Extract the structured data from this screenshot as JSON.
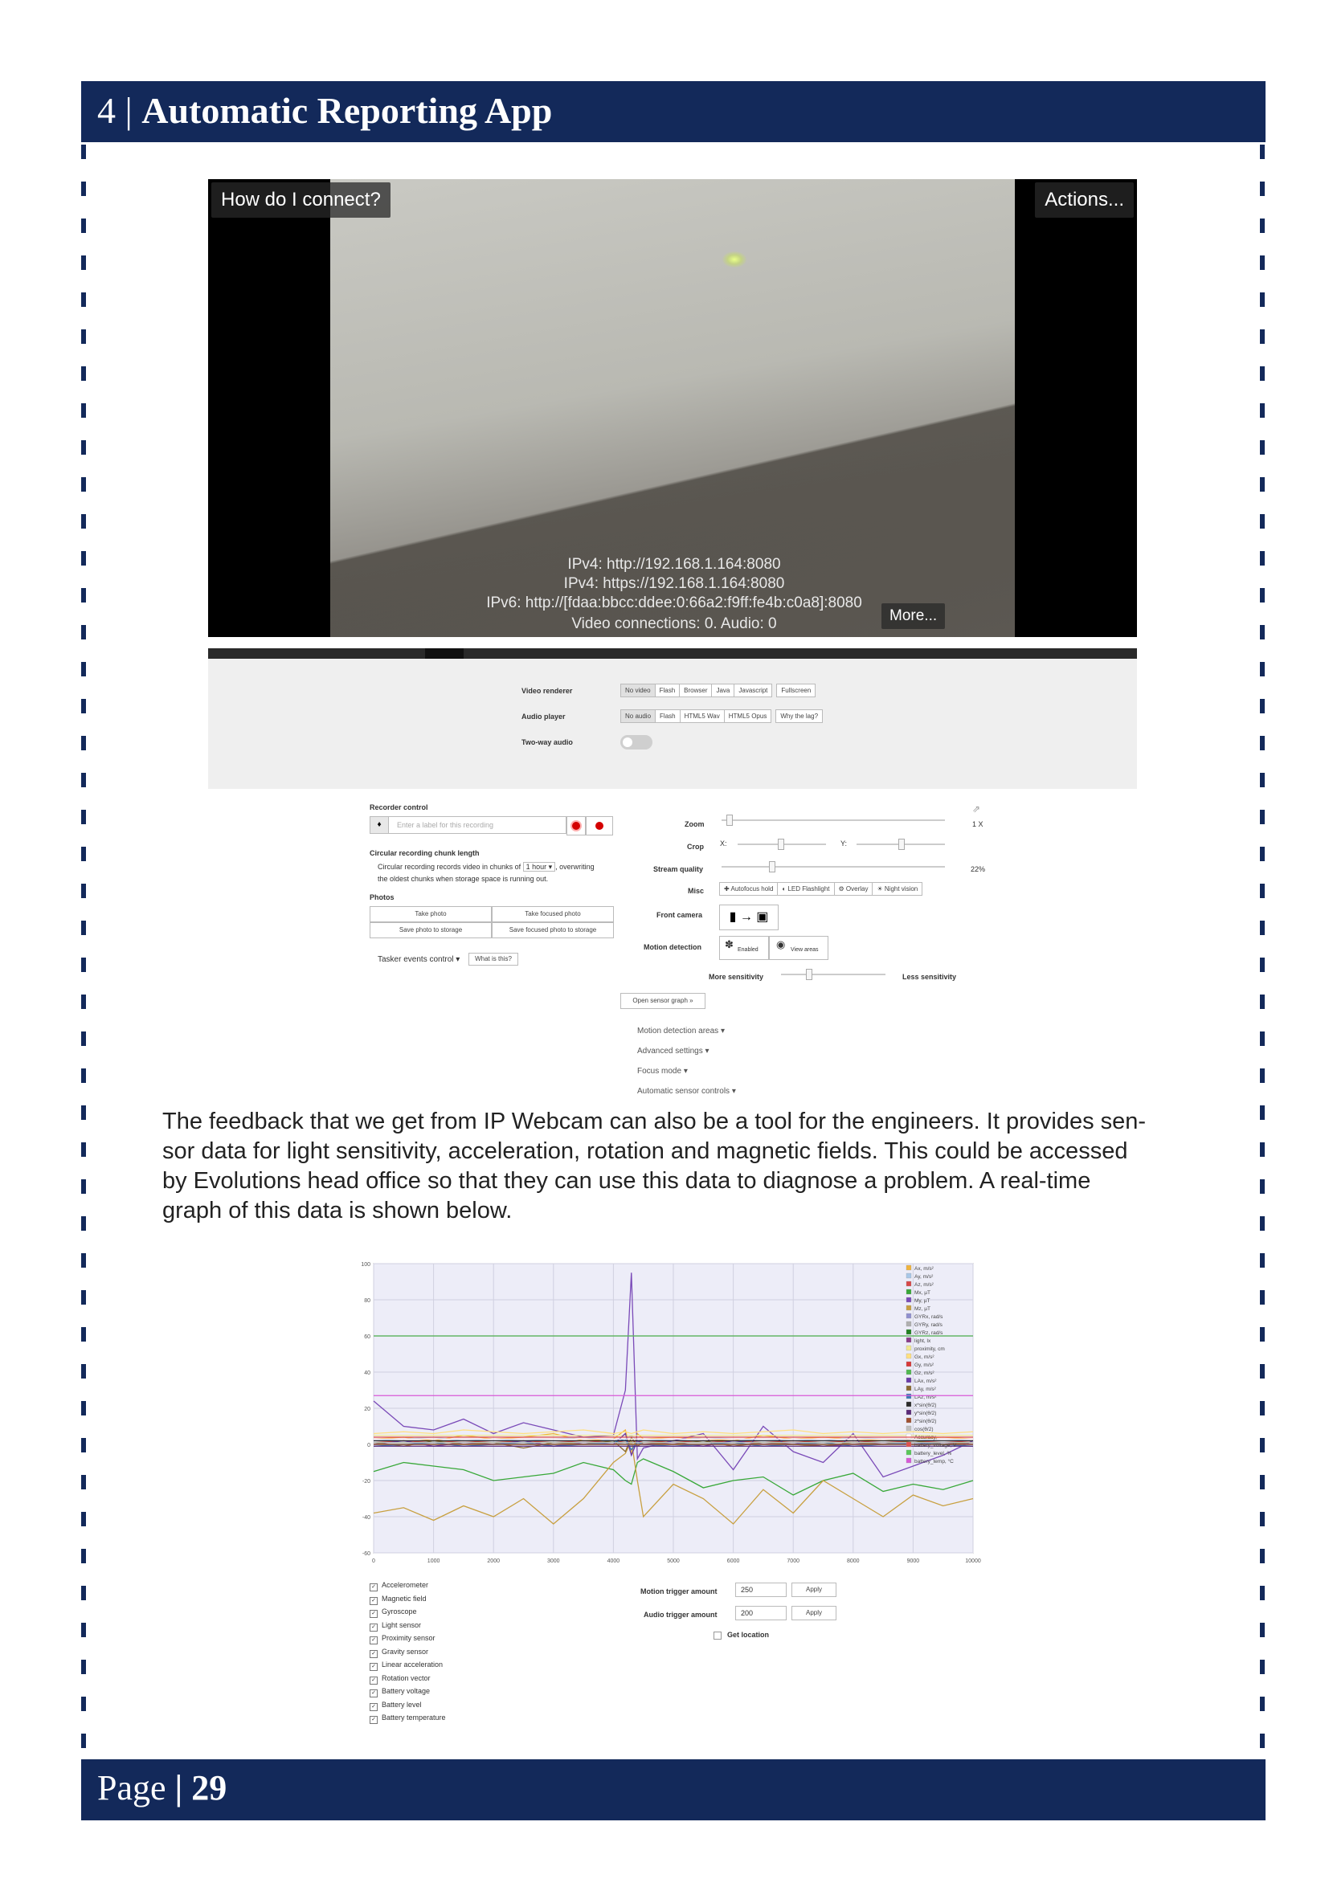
{
  "header": {
    "number": "4",
    "separator": "|",
    "title": "Automatic Reporting App"
  },
  "footer": {
    "label": "Page",
    "separator": "|",
    "number": "29"
  },
  "video": {
    "connect_button": "How do I connect?",
    "actions_button": "Actions...",
    "more_button": "More...",
    "lines": [
      "IPv4: http://192.168.1.164:8080",
      "IPv4: https://192.168.1.164:8080",
      "IPv6: http://[fdaa:bbcc:ddee:0:66a2:f9ff:fe4b:c0a8]:8080",
      "Video connections: 0. Audio: 0"
    ]
  },
  "settings": {
    "video_renderer_label": "Video renderer",
    "video_renderer_options": [
      "No video",
      "Flash",
      "Browser",
      "Java",
      "Javascript",
      "Fullscreen"
    ],
    "audio_player_label": "Audio player",
    "audio_player_options": [
      "No audio",
      "Flash",
      "HTML5 Wav",
      "HTML5 Opus",
      "Why the lag?"
    ],
    "two_way_audio_label": "Two-way audio"
  },
  "recorder": {
    "title": "Recorder control",
    "placeholder": "Enter a label for this recording",
    "chunk_title": "Circular recording chunk length",
    "chunk_text_1": "Circular recording records video in chunks of",
    "chunk_value": "1 hour",
    "chunk_text_2": ", overwriting",
    "chunk_text_3": "the oldest chunks when storage space is running out.",
    "photos_title": "Photos",
    "photo_buttons": [
      "Take photo",
      "Take focused photo",
      "Save photo to storage",
      "Save focused photo to storage"
    ],
    "tasker_label": "Tasker events control",
    "tasker_help": "What is this?"
  },
  "controls": {
    "zoom_label": "Zoom",
    "zoom_value": "1 X",
    "crop_label": "Crop",
    "crop_x": "X:",
    "crop_y": "Y:",
    "quality_label": "Stream quality",
    "quality_value": "22%",
    "misc_label": "Misc",
    "misc_buttons": [
      "Autofocus hold",
      "LED Flashlight",
      "Overlay",
      "Night vision"
    ],
    "front_camera_label": "Front camera",
    "motion_label": "Motion detection",
    "motion_enabled": "Enabled",
    "motion_view": "View areas",
    "more_sensitivity": "More sensitivity",
    "less_sensitivity": "Less sensitivity",
    "sensor_graph_button": "Open sensor graph »",
    "links": [
      "Motion detection areas",
      "Advanced settings",
      "Focus mode",
      "Automatic sensor controls"
    ]
  },
  "paragraph": [
    "The feedback that we get from IP Webcam can also be a tool for the engineers. It provides sen-",
    "sor data for light sensitivity, acceleration, rotation and magnetic fields. This could be accessed",
    "by Evolutions head office so that they can use this data to diagnose a problem. A real-time",
    "graph of this data is shown below."
  ],
  "chart_data": {
    "type": "line",
    "title": "",
    "xlabel": "",
    "ylabel": "",
    "xlim": [
      0,
      10000
    ],
    "ylim": [
      -60,
      100
    ],
    "x_ticks": [
      0,
      1000,
      2000,
      3000,
      4000,
      5000,
      6000,
      7000,
      8000,
      9000,
      10000
    ],
    "y_ticks": [
      100,
      80,
      60,
      40,
      20,
      0,
      -20,
      -40,
      -60
    ],
    "grid": true,
    "legend_position": "right",
    "x": [
      0,
      500,
      1000,
      1500,
      2000,
      2500,
      3000,
      3500,
      4000,
      4200,
      4300,
      4400,
      4500,
      5000,
      5500,
      6000,
      6500,
      7000,
      7500,
      8000,
      8500,
      9000,
      9500,
      10000
    ],
    "series": [
      {
        "name": "Ax, m/s²",
        "color": "#f0b43c",
        "values": [
          3,
          4,
          2,
          5,
          3,
          4,
          6,
          2,
          3,
          8,
          -5,
          6,
          3,
          4,
          3,
          2,
          5,
          3,
          4,
          3,
          2,
          3,
          4,
          3
        ]
      },
      {
        "name": "Ay, m/s²",
        "color": "#a8c8e8",
        "values": [
          2,
          3,
          4,
          2,
          3,
          2,
          3,
          4,
          2,
          3,
          5,
          2,
          3,
          2,
          4,
          3,
          2,
          3,
          2,
          4,
          3,
          2,
          3,
          2
        ]
      },
      {
        "name": "Az, m/s²",
        "color": "#d84848",
        "values": [
          1,
          2,
          1,
          2,
          1,
          2,
          1,
          2,
          1,
          2,
          1,
          2,
          1,
          2,
          1,
          2,
          1,
          2,
          1,
          2,
          1,
          2,
          1,
          2
        ]
      },
      {
        "name": "Mx, µT",
        "color": "#38a838",
        "values": [
          -15,
          -10,
          -12,
          -14,
          -20,
          -18,
          -16,
          -10,
          -14,
          -20,
          -22,
          -10,
          -8,
          -15,
          -24,
          -20,
          -18,
          -28,
          -20,
          -16,
          -26,
          -22,
          -25,
          -20
        ]
      },
      {
        "name": "My, µT",
        "color": "#7a4ab8",
        "values": [
          24,
          10,
          8,
          14,
          6,
          12,
          8,
          4,
          5,
          30,
          95,
          -8,
          -2,
          2,
          6,
          -14,
          10,
          -4,
          -10,
          6,
          -18,
          -12,
          -6,
          2
        ]
      },
      {
        "name": "Mz, µT",
        "color": "#c8a040",
        "values": [
          -38,
          -35,
          -42,
          -34,
          -40,
          -30,
          -44,
          -30,
          -10,
          -5,
          2,
          -20,
          -40,
          -22,
          -30,
          -44,
          -25,
          -38,
          -20,
          -30,
          -40,
          -28,
          -34,
          -30
        ]
      },
      {
        "name": "GYRx, rad/s",
        "color": "#9090d0",
        "values": [
          0,
          0,
          0,
          0,
          0,
          0,
          0,
          0,
          0,
          1,
          -1,
          0,
          0,
          0,
          0,
          0,
          0,
          0,
          0,
          0,
          0,
          0,
          0,
          0
        ]
      },
      {
        "name": "GYRy, rad/s",
        "color": "#b0b0b0",
        "values": [
          0,
          0,
          0,
          0,
          0,
          0,
          0,
          0,
          0,
          0,
          0,
          0,
          0,
          0,
          0,
          0,
          0,
          0,
          0,
          0,
          0,
          0,
          0,
          0
        ]
      },
      {
        "name": "GYRz, rad/s",
        "color": "#208020",
        "values": [
          0,
          0,
          0,
          0,
          0,
          0,
          0,
          0,
          0,
          0,
          0,
          0,
          0,
          0,
          0,
          0,
          0,
          0,
          0,
          0,
          0,
          0,
          0,
          0
        ]
      },
      {
        "name": "light, lx",
        "color": "#8a3a8a",
        "values": [
          60,
          60,
          60,
          60,
          60,
          60,
          60,
          60,
          60,
          60,
          60,
          60,
          60,
          60,
          60,
          60,
          60,
          60,
          60,
          60,
          60,
          60,
          60,
          60
        ]
      },
      {
        "name": "proximity, cm",
        "color": "#f0e890",
        "values": [
          5,
          5,
          5,
          5,
          5,
          5,
          5,
          5,
          5,
          5,
          5,
          5,
          5,
          5,
          5,
          5,
          5,
          5,
          5,
          5,
          5,
          5,
          5,
          5
        ]
      },
      {
        "name": "Gx, m/s²",
        "color": "#ffe080",
        "values": [
          6,
          7,
          6,
          8,
          7,
          6,
          7,
          8,
          6,
          7,
          6,
          7,
          8,
          6,
          7,
          6,
          7,
          8,
          6,
          7,
          6,
          7,
          6,
          7
        ]
      },
      {
        "name": "Gy, m/s²",
        "color": "#d83838",
        "values": [
          3,
          3,
          3,
          3,
          3,
          3,
          3,
          3,
          3,
          3,
          3,
          3,
          3,
          3,
          3,
          3,
          3,
          3,
          3,
          3,
          3,
          3,
          3,
          3
        ]
      },
      {
        "name": "Gz, m/s²",
        "color": "#50b850",
        "values": [
          1,
          1,
          1,
          1,
          1,
          1,
          1,
          1,
          1,
          1,
          1,
          1,
          1,
          1,
          1,
          1,
          1,
          1,
          1,
          1,
          1,
          1,
          1,
          1
        ]
      },
      {
        "name": "LAx, m/s²",
        "color": "#6a3aa8",
        "values": [
          0,
          2,
          -1,
          1,
          0,
          2,
          -1,
          1,
          0,
          6,
          -6,
          2,
          0,
          1,
          -1,
          2,
          0,
          1,
          -1,
          0,
          1,
          0,
          1,
          0
        ]
      },
      {
        "name": "LAy, m/s²",
        "color": "#8a6a30",
        "values": [
          1,
          -1,
          2,
          0,
          1,
          -2,
          1,
          0,
          2,
          -4,
          4,
          -1,
          1,
          0,
          2,
          -1,
          1,
          0,
          -1,
          1,
          0,
          2,
          0,
          1
        ]
      },
      {
        "name": "LAz, m/s²",
        "color": "#3a7ab8",
        "values": [
          -1,
          0,
          1,
          -1,
          0,
          1,
          -1,
          0,
          1,
          3,
          -3,
          1,
          0,
          -1,
          0,
          1,
          -1,
          0,
          1,
          -1,
          0,
          1,
          0,
          -1
        ]
      },
      {
        "name": "x*sin(θ/2)",
        "color": "#2a2a2a",
        "values": [
          2,
          2,
          2,
          2,
          2,
          2,
          2,
          2,
          2,
          2,
          2,
          2,
          2,
          2,
          2,
          2,
          2,
          2,
          2,
          2,
          2,
          2,
          2,
          2
        ]
      },
      {
        "name": "y*sin(θ/2)",
        "color": "#5a2a7a",
        "values": [
          -1,
          -1,
          -1,
          -1,
          -1,
          -1,
          -1,
          -1,
          -1,
          -1,
          -1,
          -1,
          -1,
          -1,
          -1,
          -1,
          -1,
          -1,
          -1,
          -1,
          -1,
          -1,
          -1,
          -1
        ]
      },
      {
        "name": "z*sin(θ/2)",
        "color": "#a05030",
        "values": [
          0,
          0,
          0,
          0,
          0,
          0,
          0,
          0,
          0,
          0,
          0,
          0,
          0,
          0,
          0,
          0,
          0,
          0,
          0,
          0,
          0,
          0,
          0,
          0
        ]
      },
      {
        "name": "cos(θ/2)",
        "color": "#c0c0c0",
        "values": [
          1,
          1,
          1,
          1,
          1,
          1,
          1,
          1,
          1,
          1,
          1,
          1,
          1,
          1,
          1,
          1,
          1,
          1,
          1,
          1,
          1,
          1,
          1,
          1
        ]
      },
      {
        "name": "Accuracy,",
        "color": "#ffffff",
        "values": [
          3,
          3,
          3,
          3,
          3,
          3,
          3,
          3,
          3,
          3,
          3,
          3,
          3,
          3,
          3,
          3,
          3,
          3,
          3,
          3,
          3,
          3,
          3,
          3
        ]
      },
      {
        "name": "battery_voltage, V",
        "color": "#e05050",
        "values": [
          4,
          4,
          4,
          4,
          4,
          4,
          4,
          4,
          4,
          4,
          4,
          4,
          4,
          4,
          4,
          4,
          4,
          4,
          4,
          4,
          4,
          4,
          4,
          4
        ]
      },
      {
        "name": "battery_level, %",
        "color": "#58c858",
        "values": [
          60,
          60,
          60,
          60,
          60,
          60,
          60,
          60,
          60,
          60,
          60,
          60,
          60,
          60,
          60,
          60,
          60,
          60,
          60,
          60,
          60,
          60,
          60,
          60
        ]
      },
      {
        "name": "battery_temp, °C",
        "color": "#d858d8",
        "values": [
          27,
          27,
          27,
          27,
          27,
          27,
          27,
          27,
          27,
          27,
          27,
          27,
          27,
          27,
          27,
          27,
          27,
          27,
          27,
          27,
          27,
          27,
          27,
          27
        ]
      }
    ]
  },
  "sensors": {
    "checkboxes": [
      "Accelerometer",
      "Magnetic field",
      "Gyroscope",
      "Light sensor",
      "Proximity sensor",
      "Gravity sensor",
      "Linear acceleration",
      "Rotation vector",
      "Battery voltage",
      "Battery level",
      "Battery temperature"
    ],
    "motion_trigger_label": "Motion trigger amount",
    "motion_trigger_value": "250",
    "audio_trigger_label": "Audio trigger amount",
    "audio_trigger_value": "200",
    "apply_label": "Apply",
    "get_location_label": "Get location"
  }
}
